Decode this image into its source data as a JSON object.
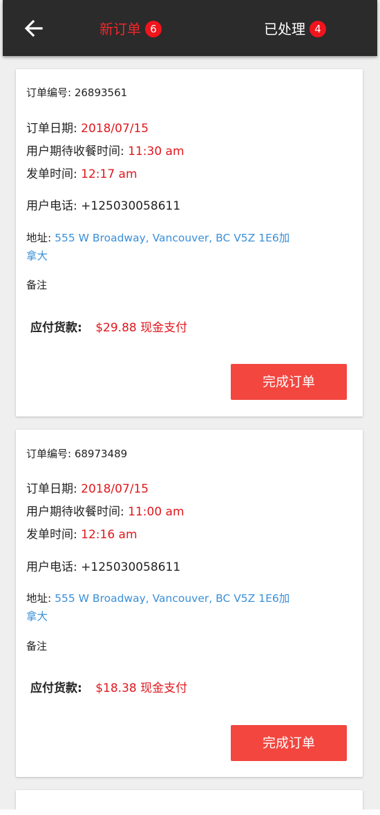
{
  "header": {
    "tabs": [
      {
        "label": "新订单",
        "badge": "6",
        "active": true
      },
      {
        "label": "已处理",
        "badge": "4",
        "active": false
      }
    ],
    "accent_color": "#f2262a",
    "bar_color": "#2b2b2b"
  },
  "labels": {
    "order_no": "订单编号: ",
    "order_date": "订单日期: ",
    "pickup_time": "用户期待收餐时间: ",
    "sent_time": "发单时间: ",
    "phone": "用户电话: ",
    "address": "地址: ",
    "note": "备注",
    "payment": "应付货款:",
    "complete_button": "完成订单"
  },
  "orders": [
    {
      "order_no": "26893561",
      "order_date": "2018/07/15",
      "pickup_time": "11:30 am",
      "sent_time": "12:17 am",
      "phone": "+125030058611",
      "address_line1": "555 W Broadway, Vancouver, BC V5Z 1E6加",
      "address_line2": "拿大",
      "payment": "$29.88 现金支付"
    },
    {
      "order_no": "68973489",
      "order_date": "2018/07/15",
      "pickup_time": "11:00 am",
      "sent_time": "12:16 am",
      "phone": "+125030058611",
      "address_line1": "555 W Broadway, Vancouver, BC V5Z 1E6加",
      "address_line2": "拿大",
      "payment": "$18.38 现金支付"
    }
  ]
}
